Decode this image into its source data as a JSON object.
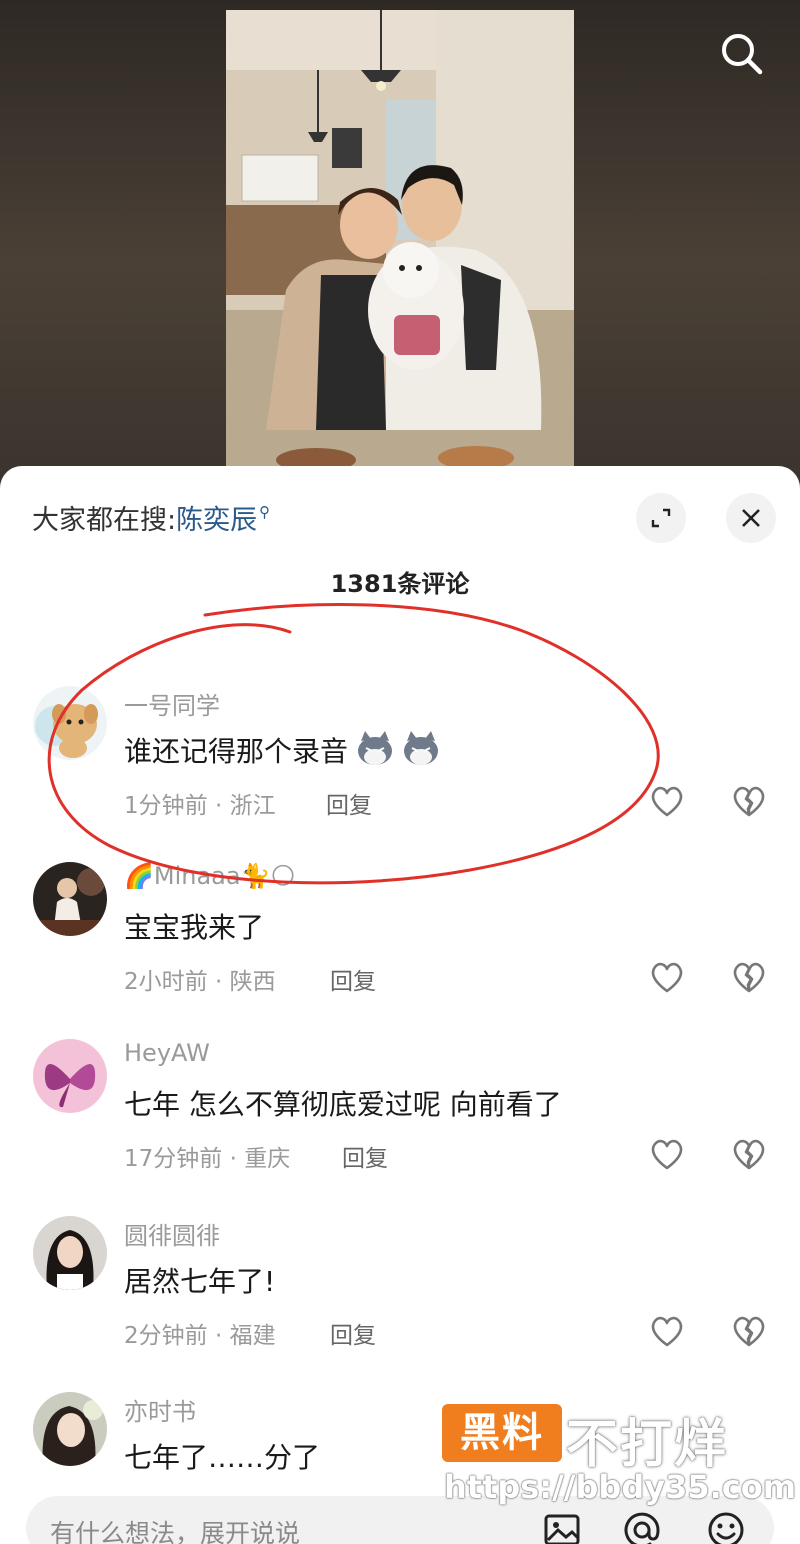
{
  "hot_search": {
    "prefix": "大家都在搜:",
    "keyword": "陈奕辰"
  },
  "comment_count": "1381条评论",
  "comments": [
    {
      "user": "一号同学",
      "text": "谁还记得那个录音",
      "time": "1分钟前",
      "location": "浙江",
      "reply": "回复"
    },
    {
      "user": "🌈Minaaa🐈🌕",
      "text": "宝宝我来了",
      "time": "2小时前",
      "location": "陕西",
      "reply": "回复"
    },
    {
      "user": "HeyAW",
      "text": "七年 怎么不算彻底爱过呢 向前看了",
      "time": "17分钟前",
      "location": "重庆",
      "reply": "回复"
    },
    {
      "user": "圆徘圆徘",
      "text": "居然七年了!",
      "time": "2分钟前",
      "location": "福建",
      "reply": "回复"
    },
    {
      "user": "亦时书",
      "text": "七年了……分了"
    }
  ],
  "input": {
    "placeholder": "有什么想法，展开说说"
  },
  "watermark": {
    "badge": "黑料",
    "text": "不打烊",
    "url": "https://bbdy35.com"
  },
  "colors": {
    "annotation": "#e0302a",
    "keyword": "#2b5a8a",
    "badge": "#f07d1e"
  },
  "icons": [
    "search-icon",
    "expand-icon",
    "close-icon",
    "heart-icon",
    "broken-heart-icon",
    "image-icon",
    "at-icon",
    "emoji-icon"
  ]
}
